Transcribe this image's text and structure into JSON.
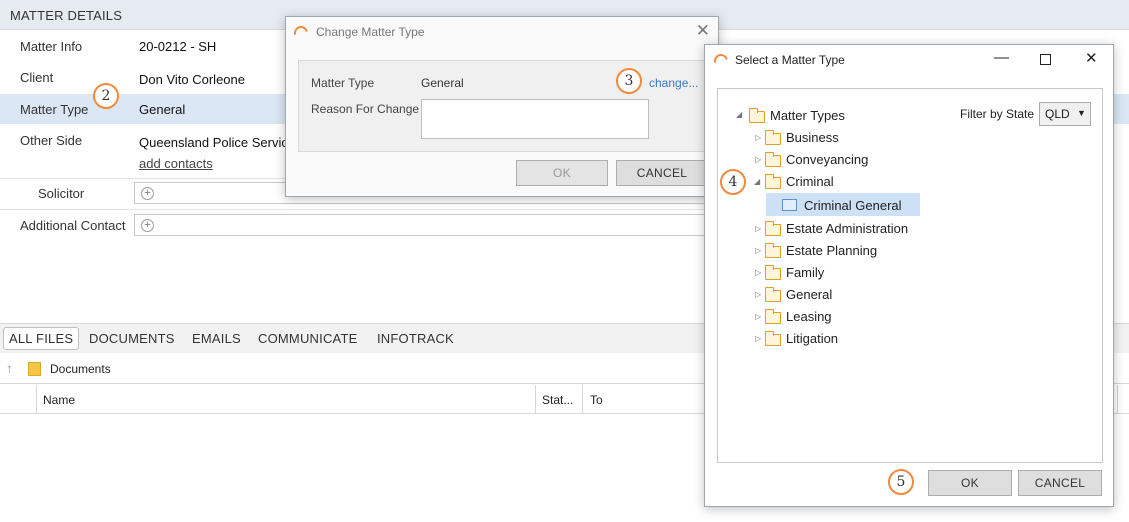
{
  "header": {
    "title": "MATTER DETAILS"
  },
  "details": {
    "matter_info_label": "Matter Info",
    "matter_info_value": "20-0212 - SH",
    "client_label": "Client",
    "client_value": "Don Vito Corleone",
    "matter_type_label": "Matter Type",
    "matter_type_value": "General",
    "other_side_label": "Other Side",
    "other_side_value": "Queensland Police Service",
    "add_contacts": "add contacts",
    "solicitor_label": "Solicitor",
    "additional_contact_label": "Additional Contact"
  },
  "callouts": {
    "c2": "2",
    "c3": "3",
    "c4": "4",
    "c5": "5"
  },
  "tabs": [
    "ALL FILES",
    "DOCUMENTS",
    "EMAILS",
    "COMMUNICATE",
    "INFOTRACK"
  ],
  "path": {
    "folder": "Documents"
  },
  "columns": {
    "name": "Name",
    "status": "Stat...",
    "to": "To"
  },
  "change_dialog": {
    "title": "Change Matter Type",
    "matter_type_label": "Matter Type",
    "matter_type_value": "General",
    "change_link": "change...",
    "reason_label": "Reason For Change",
    "reason_value": "",
    "ok": "OK",
    "cancel": "CANCEL"
  },
  "select_dialog": {
    "title": "Select a Matter Type",
    "filter_label": "Filter by State",
    "filter_value": "QLD",
    "root": "Matter Types",
    "items": [
      "Business",
      "Conveyancing",
      "Criminal",
      "Criminal General",
      "Estate Administration",
      "Estate Planning",
      "Family",
      "General",
      "Leasing",
      "Litigation"
    ],
    "ok": "OK",
    "cancel": "CANCEL"
  },
  "colors": {
    "accent": "#f08a3c",
    "selection": "#cde0f5",
    "link": "#3a78c9"
  }
}
